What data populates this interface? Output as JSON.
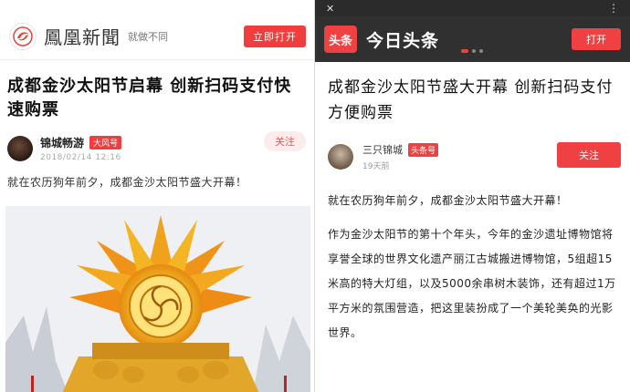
{
  "left": {
    "brand": "鳳凰新聞",
    "slogan": "就做不同",
    "open_button": "立即打开",
    "article": {
      "title": "成都金沙太阳节启幕 创新扫码支付快速购票",
      "author": "锦城畅游",
      "badge": "大风号",
      "date": "2018/02/14 12:16",
      "follow": "关注",
      "body": "就在农历狗年前夕，成都金沙太阳节盛大开幕！"
    },
    "colors": {
      "accent": "#f03d3d"
    }
  },
  "right": {
    "brand_logo": "头条",
    "brand": "今日头条",
    "open_button": "打开",
    "article": {
      "title": "成都金沙太阳节盛大开幕 创新扫码支付方便购票",
      "author": "三只锦城",
      "badge": "头条号",
      "time": "19天前",
      "follow": "关注",
      "paragraph1": "就在农历狗年前夕，成都金沙太阳节盛大开幕！",
      "paragraph2": "作为金沙太阳节的第十个年头，今年的金沙遗址博物馆将享誉全球的世界文化遗产丽江古城搬进博物馆，5组超15米高的特大灯组，以及5000余串树木装饰，还有超过1万平方米的氛围营造，把这里装扮成了一个美轮美奂的光影世界。"
    },
    "colors": {
      "accent": "#f04142",
      "header": "#303030"
    }
  }
}
